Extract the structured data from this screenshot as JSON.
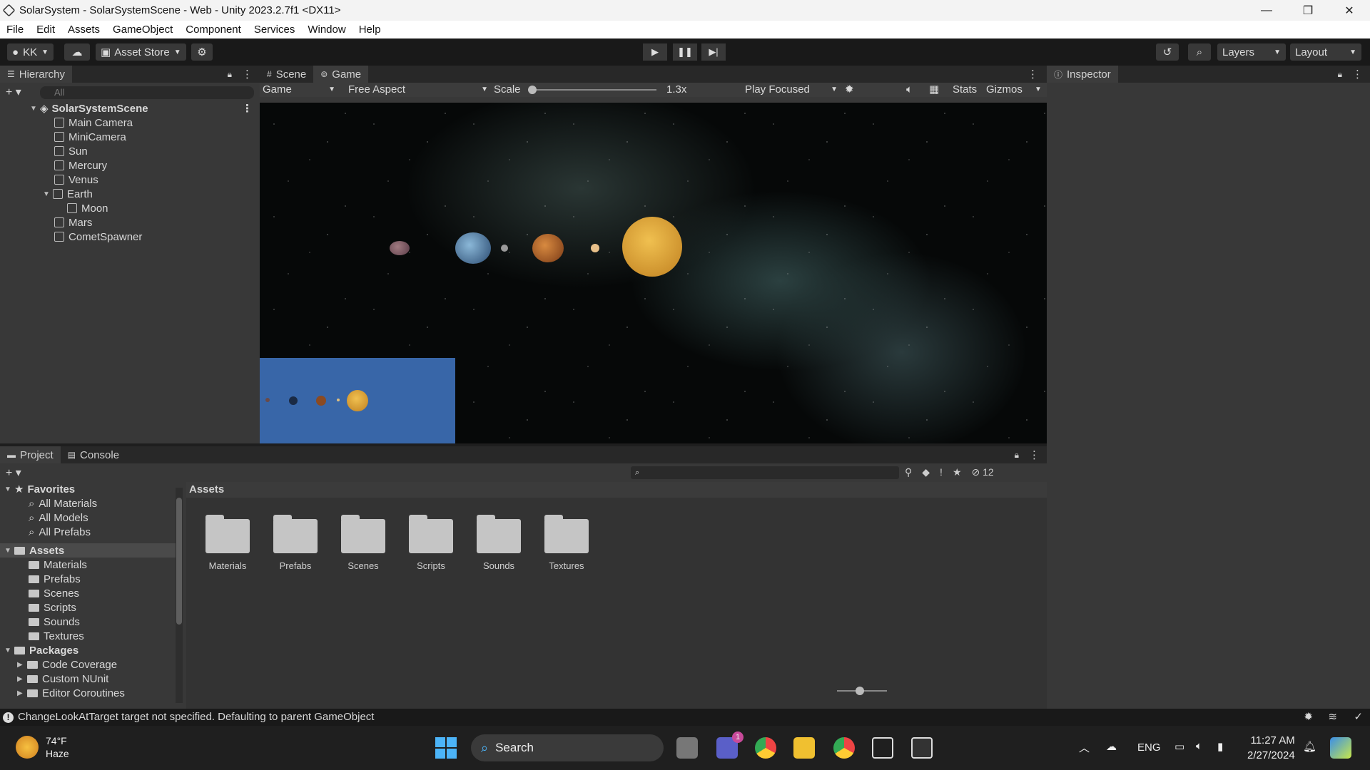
{
  "window": {
    "title": "SolarSystem - SolarSystemScene - Web - Unity 2023.2.7f1 <DX11>",
    "controls": [
      "—",
      "❐",
      "✕"
    ]
  },
  "menu": [
    "File",
    "Edit",
    "Assets",
    "GameObject",
    "Component",
    "Services",
    "Window",
    "Help"
  ],
  "toolbar": {
    "account": "KK",
    "asset_store": "Asset Store",
    "layers": "Layers",
    "layout": "Layout"
  },
  "hierarchy": {
    "tab": "Hierarchy",
    "search_placeholder": "All",
    "scene": "SolarSystemScene",
    "items": [
      "Main Camera",
      "MiniCamera",
      "Sun",
      "Mercury",
      "Venus",
      "Earth",
      "Moon",
      "Mars",
      "CometSpawner"
    ]
  },
  "gameview": {
    "tabs": [
      "Scene",
      "Game"
    ],
    "display": "Game",
    "aspect": "Free Aspect",
    "scale_label": "Scale",
    "scale_value": "1.3x",
    "play_mode": "Play Focused",
    "stats": "Stats",
    "gizmos": "Gizmos"
  },
  "inspector": {
    "tab": "Inspector"
  },
  "project": {
    "tabs": [
      "Project",
      "Console"
    ],
    "favorites": "Favorites",
    "fav_items": [
      "All Materials",
      "All Models",
      "All Prefabs"
    ],
    "assets_label": "Assets",
    "asset_folders": [
      "Materials",
      "Prefabs",
      "Scenes",
      "Scripts",
      "Sounds",
      "Textures"
    ],
    "packages_label": "Packages",
    "packages": [
      "Code Coverage",
      "Custom NUnit",
      "Editor Coroutines"
    ],
    "hidden_count": "12"
  },
  "status": {
    "message": "ChangeLookAtTarget target not specified. Defaulting to parent GameObject"
  },
  "taskbar": {
    "weather_temp": "74°F",
    "weather_desc": "Haze",
    "search": "Search",
    "lang": "ENG",
    "time": "11:27 AM",
    "date": "2/27/2024",
    "teams_badge": "1"
  }
}
